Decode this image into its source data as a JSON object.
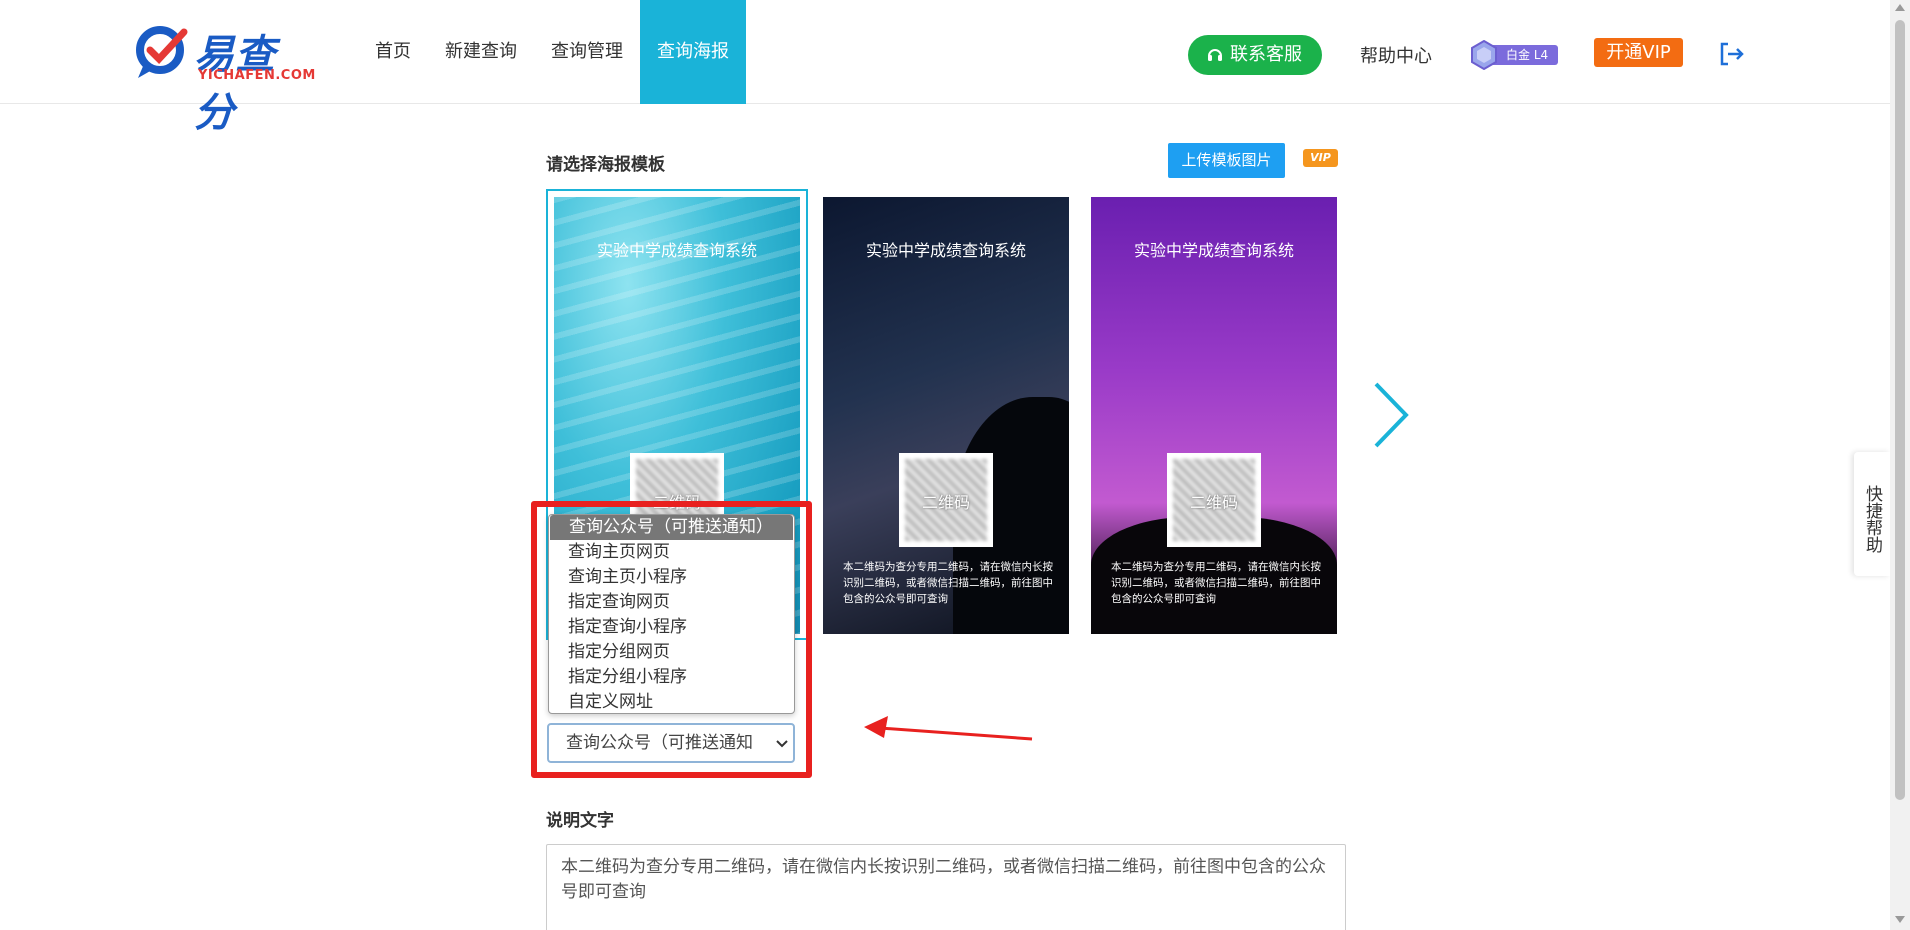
{
  "header": {
    "logo_cn": "易查分",
    "logo_en": "YICHAFEN.COM",
    "nav": [
      "首页",
      "新建查询",
      "查询管理",
      "查询海报"
    ],
    "active_nav": "查询海报",
    "contact_label": "联系客服",
    "help_label": "帮助中心",
    "badge_label": "白金 L4",
    "vip_label": "开通VIP"
  },
  "poster": {
    "section_title": "请选择海报模板",
    "upload_label": "上传模板图片",
    "vip_tag": "VIP",
    "templates": [
      {
        "title": "实验中学成绩查询系统",
        "qr_label": "二维码",
        "desc": ""
      },
      {
        "title": "实验中学成绩查询系统",
        "qr_label": "二维码",
        "desc": "本二维码为查分专用二维码，请在微信内长按识别二维码，或者微信扫描二维码，前往图中包含的公众号即可查询"
      },
      {
        "title": "实验中学成绩查询系统",
        "qr_label": "二维码",
        "desc": "本二维码为查分专用二维码，请在微信内长按识别二维码，或者微信扫描二维码，前往图中包含的公众号即可查询"
      }
    ]
  },
  "qr_type": {
    "options": [
      "查询公众号（可推送通知）",
      "查询主页网页",
      "查询主页小程序",
      "指定查询网页",
      "指定查询小程序",
      "指定分组网页",
      "指定分组小程序",
      "自定义网址"
    ],
    "selected_display": "查询公众号（可推送通知"
  },
  "description": {
    "label": "说明文字",
    "value": "本二维码为查分专用二维码，请在微信内长按识别二维码，或者微信扫描二维码，前往图中包含的公众号即可查询"
  },
  "quick_help": "快捷帮助",
  "colors": {
    "accent": "#1ab3d8",
    "contact_green": "#1bb24b",
    "vip_orange": "#f36c12",
    "upload_blue": "#1e9ff2",
    "highlight_red": "#e8211f"
  }
}
